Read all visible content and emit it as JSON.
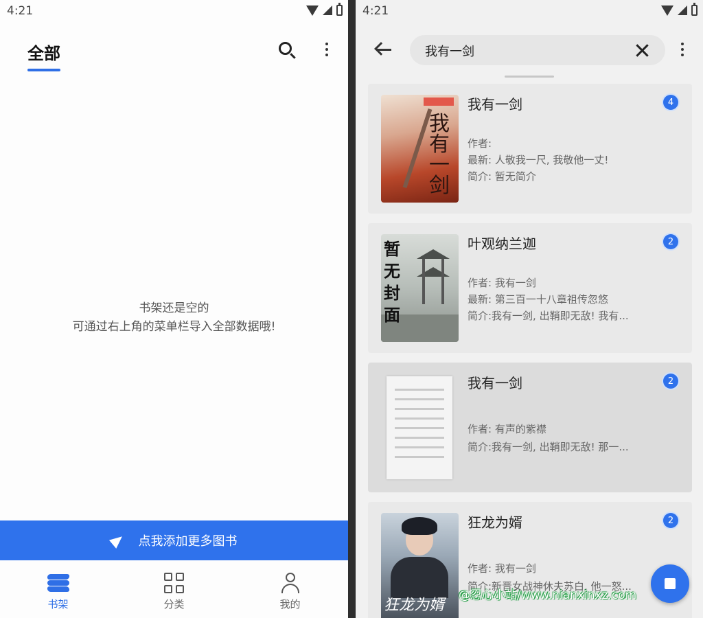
{
  "left": {
    "status": {
      "time": "4:21"
    },
    "header": {
      "tab_label": "全部"
    },
    "empty": {
      "line1": "书架还是空的",
      "line2": "可通过右上角的菜单栏导入全部数据哦!"
    },
    "add_bar": {
      "label": "点我添加更多图书"
    },
    "nav": [
      {
        "label": "书架",
        "icon": "bookshelf-icon",
        "active": true
      },
      {
        "label": "分类",
        "icon": "grid-icon",
        "active": false
      },
      {
        "label": "我的",
        "icon": "person-icon",
        "active": false
      }
    ],
    "accent_color": "#2f72ec"
  },
  "right": {
    "status": {
      "time": "4:21"
    },
    "search": {
      "query": "我有一剑"
    },
    "results": [
      {
        "title": "我有一剑",
        "count": "4",
        "author": "作者:",
        "latest": "最新: 人敬我一尺, 我敬他一丈!",
        "intro": "简介: 暂无简介"
      },
      {
        "title": "叶观纳兰迦",
        "count": "2",
        "author": "作者: 我有一剑",
        "latest": "最新: 第三百一十八章祖传忽悠",
        "intro": "简介:我有一剑, 出鞘即无敌! 我有..."
      },
      {
        "title": "我有一剑",
        "count": "2",
        "author": "作者: 有声的紫襟",
        "intro": "简介:我有一剑, 出鞘即无敌! 那一..."
      },
      {
        "title": "狂龙为婿",
        "count": "2",
        "author": "作者: 我有一剑",
        "intro": "简介:新晋女战神休夫苏白, 他一怒..."
      }
    ],
    "covers": {
      "cover1_text": "我有一剑",
      "cover2_text": "暂无封面",
      "cover4_text": "狂龙为婿"
    },
    "watermark": "@忍心小站/www.nianxinxz.com"
  }
}
